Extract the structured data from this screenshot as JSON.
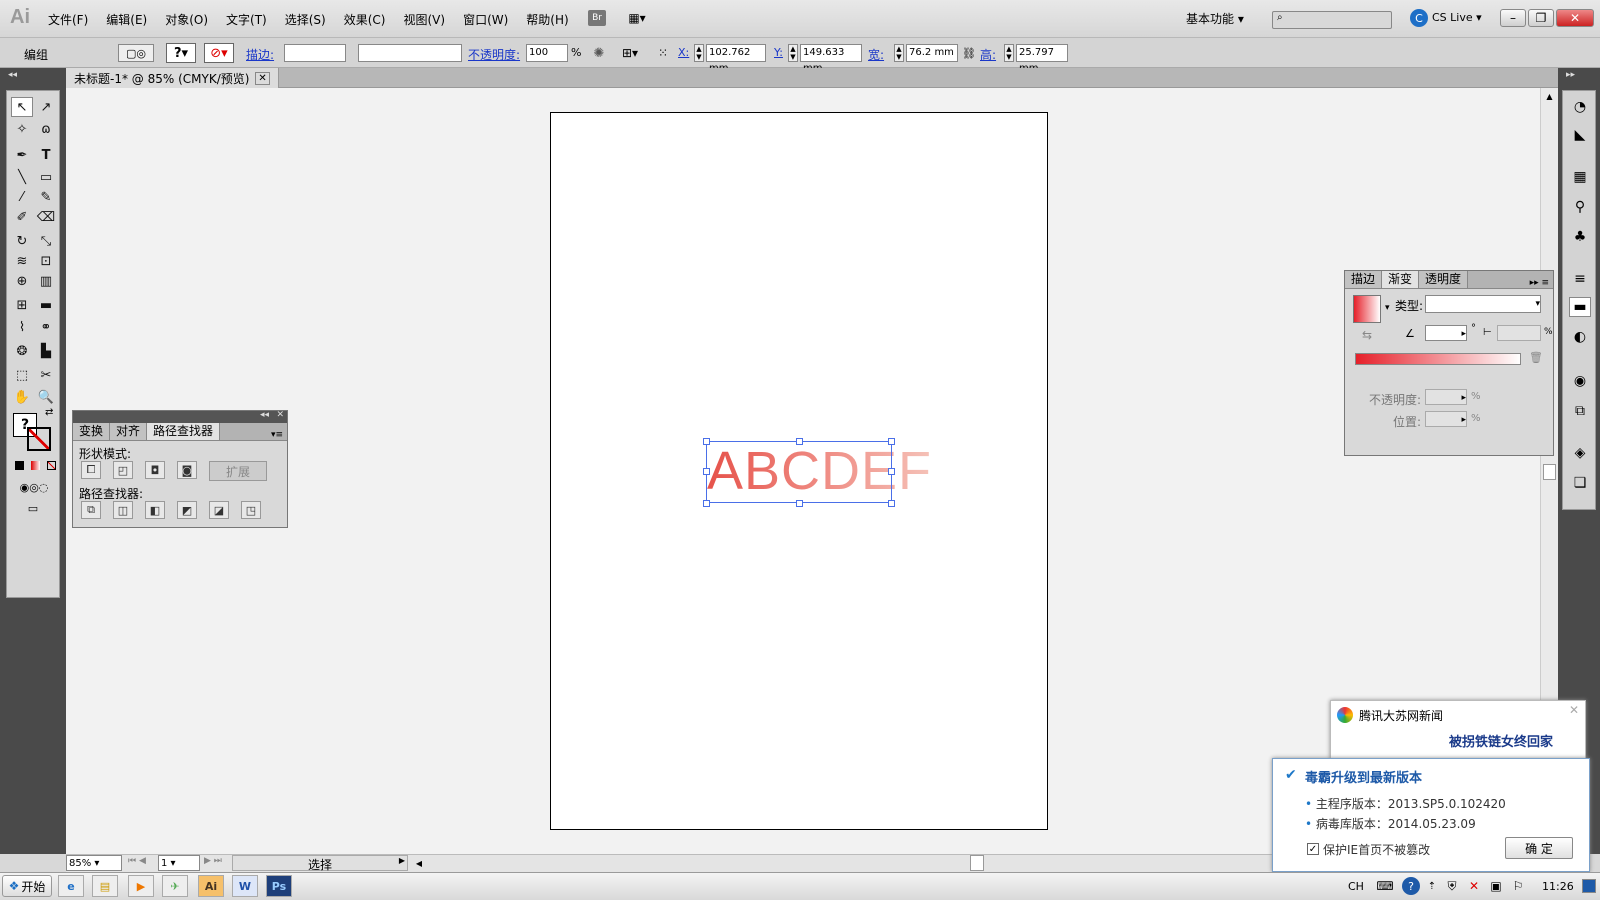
{
  "app": {
    "logo": "Ai"
  },
  "menu": [
    "文件(F)",
    "编辑(E)",
    "对象(O)",
    "文字(T)",
    "选择(S)",
    "效果(C)",
    "视图(V)",
    "窗口(W)",
    "帮助(H)"
  ],
  "menubar_right": {
    "br_label": "Br",
    "workspace": "基本功能",
    "cslive": "CS Live"
  },
  "control": {
    "object_type": "编组",
    "stroke_label": "描边:",
    "opacity_label": "不透明度:",
    "opacity_value": "100",
    "percent": "%",
    "x_label": "X:",
    "x_value": "102.762 mm",
    "y_label": "Y:",
    "y_value": "149.633 mm",
    "w_label": "宽:",
    "w_value": "76.2 mm",
    "h_label": "高:",
    "h_value": "25.797 mm"
  },
  "document": {
    "tab_title": "未标题-1* @ 85% (CMYK/预览)",
    "artwork_text": "ABCDEF"
  },
  "pathfinder_panel": {
    "tabs": [
      "变换",
      "对齐",
      "路径查找器"
    ],
    "shape_modes_label": "形状模式:",
    "expand_button": "扩展",
    "pathfinders_label": "路径查找器:"
  },
  "gradient_panel": {
    "tabs": [
      "描边",
      "渐变",
      "透明度"
    ],
    "type_label": "类型:",
    "degree_symbol": "°",
    "percent": "%",
    "opacity_label": "不透明度:",
    "position_label": "位置:"
  },
  "statusbar": {
    "zoom": "85%",
    "page": "1",
    "status": "选择"
  },
  "news_popup": {
    "title": "腾讯大苏网新闻",
    "headline": "被拐铁链女终回家"
  },
  "update_popup": {
    "title": "毒霸升级到最新版本",
    "main_version": "主程序版本：2013.SP5.0.102420",
    "virus_version": "病毒库版本：2014.05.23.09",
    "checkbox_label": "保护IE首页不被篡改",
    "ok_button": "确 定"
  },
  "taskbar": {
    "start": "开始",
    "lang": "CH",
    "time": "11:26",
    "apps": [
      "Ai",
      "W",
      "Ps"
    ]
  },
  "colors": {
    "accent_blue": "#1a37c9",
    "selection": "#4a6fe8",
    "gradient_start": "#e6202a",
    "gradient_end": "#ffffff"
  }
}
